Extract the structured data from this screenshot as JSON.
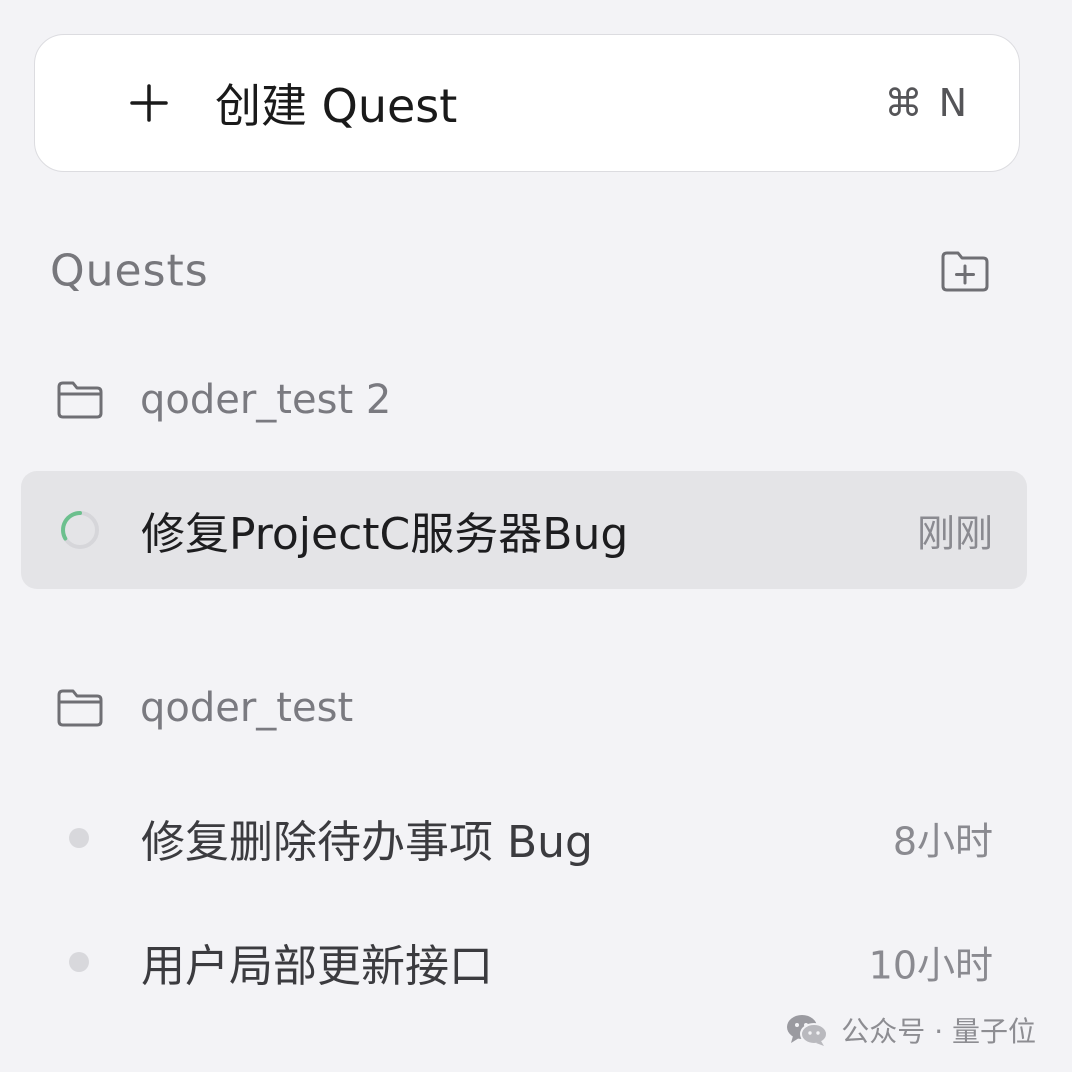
{
  "create_button": {
    "label": "创建 Quest",
    "shortcut": "⌘ N",
    "icon": "plus-icon"
  },
  "quests_section": {
    "title": "Quests",
    "new_folder_icon": "folder-plus-icon"
  },
  "groups": [
    {
      "name": "qoder_test 2",
      "icon": "folder-icon",
      "quests": [
        {
          "title": "修复ProjectC服务器Bug",
          "time": "刚刚",
          "status": "in-progress",
          "active": true
        }
      ]
    },
    {
      "name": "qoder_test",
      "icon": "folder-icon",
      "quests": [
        {
          "title": "修复删除待办事项 Bug",
          "time": "8小时",
          "status": "idle"
        },
        {
          "title": "用户局部更新接口",
          "time": "10小时",
          "status": "idle"
        }
      ]
    }
  ],
  "watermark": {
    "text": "公众号 · 量子位",
    "icon": "wechat-icon"
  },
  "colors": {
    "background": "#f3f3f6",
    "active_row": "#e4e4e7",
    "spinner_accent": "#6cc08e",
    "muted_text": "#7a7a80"
  }
}
